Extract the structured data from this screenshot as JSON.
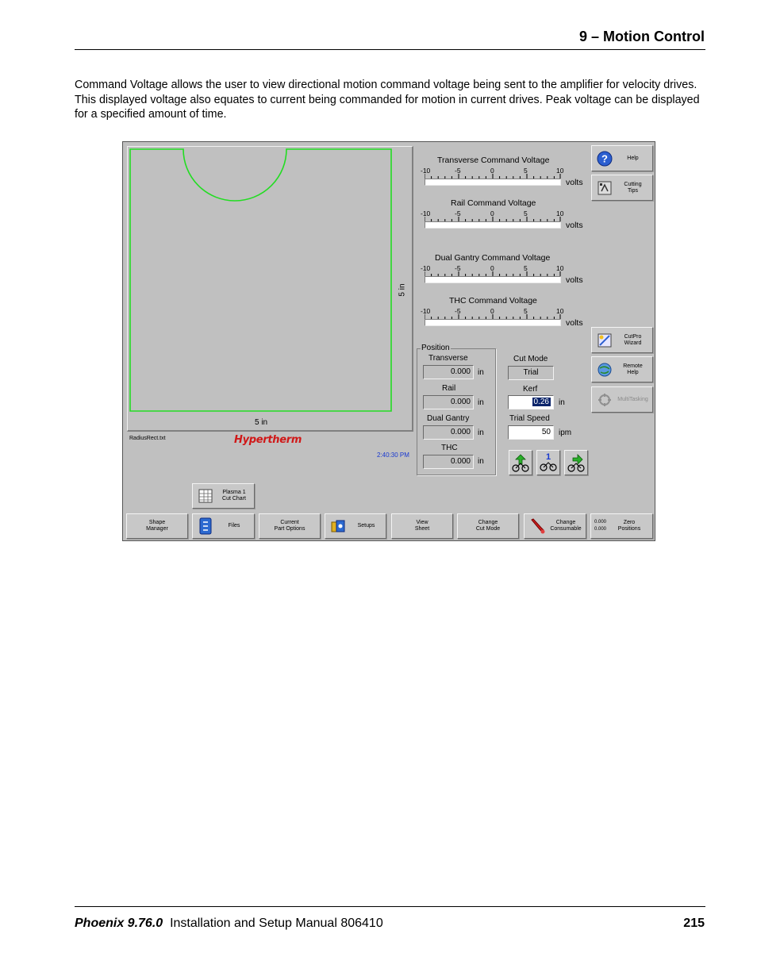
{
  "header": {
    "title": "9  –  Motion Control"
  },
  "intro": "Command Voltage allows the user to view directional motion command voltage being sent to the amplifier for velocity drives. This displayed voltage also equates to current being commanded for motion in current drives. Peak voltage can be displayed for a specified amount of time.",
  "footer": {
    "product": "Phoenix 9.76.0",
    "manual": "Installation and Setup Manual  806410",
    "page": "215"
  },
  "screen": {
    "view": {
      "width_label": "5 in",
      "height_label": "5 in",
      "file_name": "RadiusRect.txt",
      "clock": "2:40:30 PM",
      "logo": "Hypertherm"
    },
    "meters": [
      {
        "title": "Transverse Command Voltage",
        "unit": "volts"
      },
      {
        "title": "Rail Command Voltage",
        "unit": "volts"
      },
      {
        "title": "Dual Gantry Command Voltage",
        "unit": "volts"
      },
      {
        "title": "THC Command Voltage",
        "unit": "volts"
      }
    ],
    "scale": [
      "-10",
      "-5",
      "0",
      "5",
      "10"
    ],
    "position": {
      "title": "Position",
      "rows": [
        {
          "label": "Transverse",
          "value": "0.000",
          "unit": "in"
        },
        {
          "label": "Rail",
          "value": "0.000",
          "unit": "in"
        },
        {
          "label": "Dual Gantry",
          "value": "0.000",
          "unit": "in"
        },
        {
          "label": "THC",
          "value": "0.000",
          "unit": "in"
        }
      ]
    },
    "cut_mode": {
      "label": "Cut Mode",
      "value": "Trial"
    },
    "kerf": {
      "label": "Kerf",
      "value": "0.26",
      "unit": "in"
    },
    "trial_speed": {
      "label": "Trial Speed",
      "value": "50",
      "unit": "ipm"
    },
    "side_buttons": {
      "help": "Help",
      "cutting_tips": "Cutting\nTips",
      "cutpro_wizard": "CutPro\nWizard",
      "remote_help": "Remote\nHelp",
      "multitasking": "MultiTasking"
    },
    "plasma_cut_chart": "Plasma 1\nCut Chart",
    "motion_button_number": "1",
    "softkeys": [
      "Shape\nManager",
      "Files",
      "Current\nPart Options",
      "Setups",
      "View\nSheet",
      "Change\nCut Mode",
      "Change\nConsumable",
      "Zero\nPositions"
    ],
    "zero_positions_readout": [
      "0.000",
      "0.000"
    ],
    "colors": {
      "part_outline": "#22dd22",
      "selection": "#0a246a",
      "logo": "#d01818",
      "clock": "#1838d0"
    }
  }
}
